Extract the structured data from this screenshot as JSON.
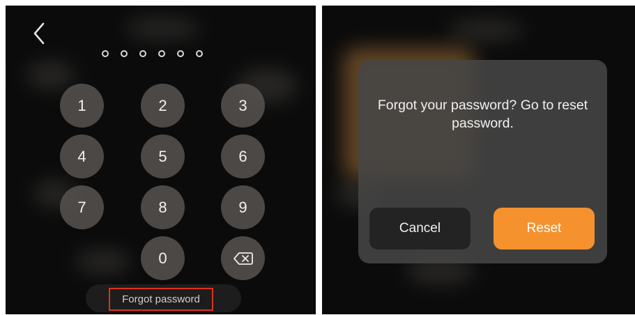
{
  "lock_screen": {
    "passcode_length": 6,
    "keys": [
      "1",
      "2",
      "3",
      "4",
      "5",
      "6",
      "7",
      "8",
      "9",
      "0"
    ],
    "backspace_icon": "backspace-icon",
    "back_icon": "chevron-left-icon",
    "forgot_label": "Forgot password"
  },
  "dialog": {
    "message": "Forgot your password? Go to reset password.",
    "cancel_label": "Cancel",
    "reset_label": "Reset"
  },
  "colors": {
    "accent": "#f5922e",
    "highlight_border": "#e2301f",
    "key_bg": "#58544f",
    "background": "#0b0b0b"
  }
}
